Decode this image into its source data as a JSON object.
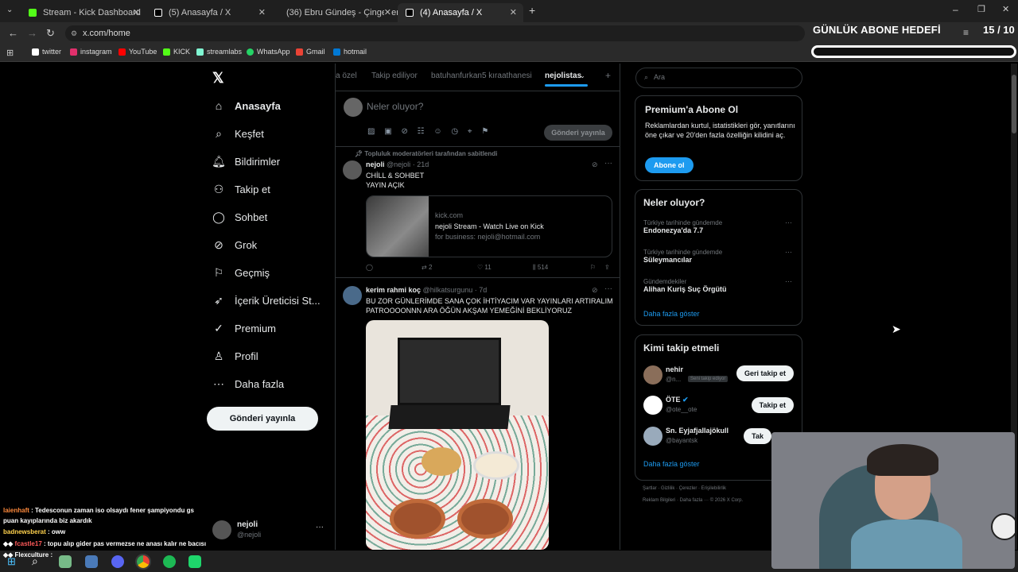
{
  "tabs": [
    {
      "label": "Stream - Kick Dashboard",
      "color": "#53fc18"
    },
    {
      "label": "(5) Anasayfa / X",
      "color": "#ffffff"
    },
    {
      "label": "(36) Ebru Gündeş - Çingenem (",
      "color": "#ff0000"
    },
    {
      "label": "(4) Anasayfa / X",
      "color": "#ffffff"
    }
  ],
  "url": "x.com/home",
  "bookmarks": [
    {
      "label": "twitter",
      "color": "#ffffff"
    },
    {
      "label": "instagram",
      "color": "#e1306c"
    },
    {
      "label": "YouTube",
      "color": "#ff0000"
    },
    {
      "label": "KICK",
      "color": "#53fc18"
    },
    {
      "label": "streamlabs",
      "color": "#80f5d2"
    },
    {
      "label": "WhatsApp",
      "color": "#25d366"
    },
    {
      "label": "Gmail",
      "color": "#ea4335"
    },
    {
      "label": "hotmail",
      "color": "#0078d4"
    }
  ],
  "goal": {
    "title": "GÜNLÜK ABONE HEDEFİ",
    "count": "15 / 10"
  },
  "sidebar": {
    "items": [
      {
        "label": "Anasayfa",
        "icon": "home-icon"
      },
      {
        "label": "Keşfet",
        "icon": "search-icon"
      },
      {
        "label": "Bildirimler",
        "icon": "bell-icon"
      },
      {
        "label": "Takip et",
        "icon": "add-user-icon"
      },
      {
        "label": "Sohbet",
        "icon": "chat-icon"
      },
      {
        "label": "Grok",
        "icon": "grok-icon"
      },
      {
        "label": "Geçmiş",
        "icon": "bookmark-icon"
      },
      {
        "label": "İçerik Üreticisi St...",
        "icon": "rocket-icon"
      },
      {
        "label": "Premium",
        "icon": "verified-icon"
      },
      {
        "label": "Profil",
        "icon": "profile-icon"
      },
      {
        "label": "Daha fazla",
        "icon": "more-icon"
      }
    ],
    "post_button": "Gönderi yayınla",
    "account": {
      "name": "nejoli",
      "handle": "@nejoli"
    }
  },
  "main": {
    "tabs": [
      "a özel",
      "Takip ediliyor",
      "batuhanfurkan5 kıraathanesi",
      "nejolistas"
    ],
    "composer": {
      "placeholder": "Neler oluyor?",
      "button": "Gönderi yayınla"
    },
    "pinned_label": "Topluluk moderatörleri tarafından sabitlendi",
    "post1": {
      "name": "nejoli",
      "handle": "@nejoli",
      "time": "21d",
      "text1": "CHİLL & SOHBET",
      "text2": "YAYIN AÇIK",
      "link_domain": "kick.com",
      "link_title": "nejoli Stream - Watch Live on Kick",
      "link_desc": "for business: nejoli@hotmail.com",
      "retweets": "2",
      "likes": "11",
      "views": "514"
    },
    "post2": {
      "name": "kerim rahmi koç",
      "handle": "@hilkatsurgunu",
      "time": "7d",
      "text1": "BU ZOR GÜNLERİMDE SANA ÇOK İHTİYACIM VAR YAYINLARI ARTIRALIM",
      "text2": "PATROOOONNN ARA ÖĞÜN AKŞAM YEMEĞİNİ BEKLİYORUZ"
    }
  },
  "right": {
    "search_placeholder": "Ara",
    "premium": {
      "title": "Premium'a Abone Ol",
      "text": "Reklamlardan kurtul, istatistikleri gör, yanıtlarını öne çıkar ve 20'den fazla özelliğin kilidini aç.",
      "button": "Abone ol"
    },
    "trends_title": "Neler oluyor?",
    "trends": [
      {
        "meta": "Türkiye tarihinde gündemde",
        "name": "Endonezya'da 7.7"
      },
      {
        "meta": "Türkiye tarihinde gündemde",
        "name": "Süleymancılar"
      },
      {
        "meta": "Gündemdekiler",
        "name": "Alihan Kuriş Suç Örgütü"
      }
    ],
    "show_more": "Daha fazla göster",
    "who_title": "Kimi takip etmeli",
    "who": [
      {
        "name": "nehir",
        "handle": "@n...",
        "badge": "Seni takip ediyor",
        "button": "Geri takip et"
      },
      {
        "name": "ÖTE",
        "handle": "@ote__ote",
        "button": "Takip et"
      },
      {
        "name": "Sn. Eyjafjallajökull",
        "handle": "@bayantsk",
        "button": "Tak"
      }
    ],
    "footer1": "Şartlar · Gizlilik · Çerezler · Erişilebilirlik",
    "footer2": "Reklam Bilgileri · Daha fazla ··· © 2026 X Corp."
  },
  "chat": [
    {
      "user": "laienhaft",
      "text": "Tedesconun zaman iso olsaydı fener şampiyondu gs puan kayıplarında biz akardık"
    },
    {
      "user": "badnewsberat",
      "text": "oww"
    },
    {
      "user": "fcastle17",
      "text": "topu alıp gider pas vermezse ne anası kalır ne bacısı"
    },
    {
      "user": "Flexculture",
      "text": ""
    }
  ]
}
